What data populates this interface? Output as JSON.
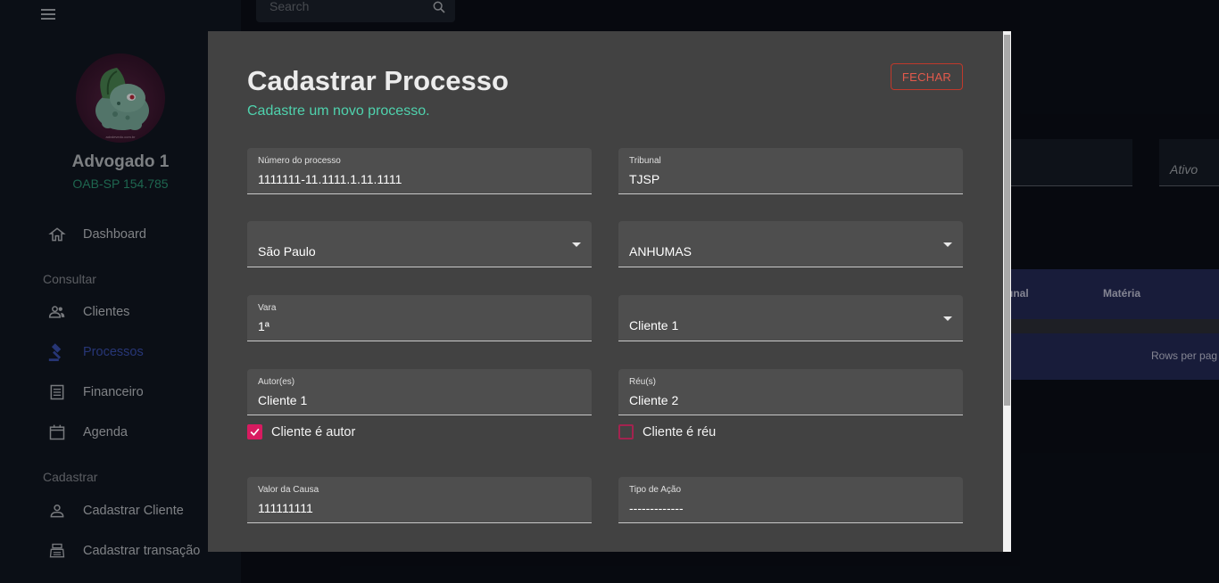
{
  "sidebar": {
    "user": {
      "name": "Advogado 1",
      "oab": "OAB-SP 154.785",
      "avatar_caption": "advdevedo.com.br"
    },
    "sections": {
      "consultar": "Consultar",
      "cadastrar": "Cadastrar"
    },
    "items": [
      {
        "label": "Dashboard",
        "icon": "home-icon"
      },
      {
        "label": "Clientes",
        "icon": "people-icon"
      },
      {
        "label": "Processos",
        "icon": "gavel-icon",
        "active": true
      },
      {
        "label": "Financeiro",
        "icon": "receipt-icon"
      },
      {
        "label": "Agenda",
        "icon": "calendar-icon"
      },
      {
        "label": "Cadastrar Cliente",
        "icon": "person-icon"
      },
      {
        "label": "Cadastrar transação",
        "icon": "register-icon"
      }
    ]
  },
  "background": {
    "search_placeholder": "Search",
    "filter_value": "Ativo",
    "table": {
      "columns": [
        "unal",
        "Matéria"
      ],
      "footer": "Rows per pag"
    }
  },
  "modal": {
    "title": "Cadastrar Processo",
    "subtitle": "Cadastre um novo processo.",
    "close_label": "FECHAR",
    "fields": {
      "numero": {
        "label": "Número do processo",
        "value": "1111111-11.1111.1.11.1111"
      },
      "tribunal": {
        "label": "Tribunal",
        "value": "TJSP"
      },
      "estado": {
        "value": "São Paulo"
      },
      "comarca": {
        "value": "ANHUMAS"
      },
      "vara": {
        "label": "Vara",
        "value": "1ª"
      },
      "cliente": {
        "value": "Cliente 1"
      },
      "autores": {
        "label": "Autor(es)",
        "value": "Cliente 1"
      },
      "reus": {
        "label": "Réu(s)",
        "value": "Cliente 2"
      },
      "valor": {
        "label": "Valor da Causa",
        "value": "111111111"
      },
      "tipo_acao": {
        "label": "Tipo de Ação",
        "value": "-------------"
      }
    },
    "checkboxes": {
      "cliente_autor": {
        "label": "Cliente é autor",
        "checked": true
      },
      "cliente_reu": {
        "label": "Cliente é réu",
        "checked": false
      }
    }
  },
  "colors": {
    "accent_green": "#4fd2ad",
    "accent_pink": "#d81b60",
    "close_red": "#e35a4c",
    "active_nav": "#3c53b6"
  }
}
